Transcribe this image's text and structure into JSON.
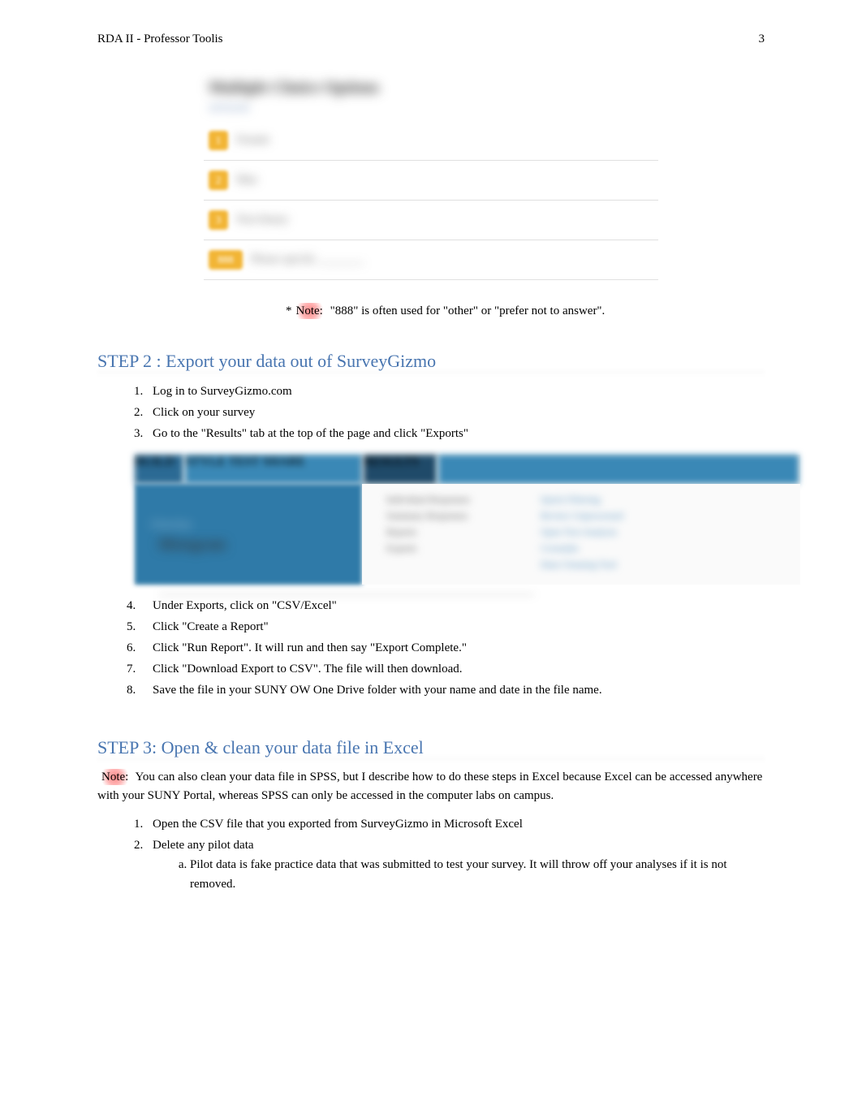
{
  "header": {
    "left": "RDA II - Professor Toolis",
    "page_number": "3"
  },
  "figure1": {
    "title": "Multiple Choice Options",
    "subtitle": "OPTIONS",
    "options": [
      {
        "num": "1",
        "label": "Female"
      },
      {
        "num": "2",
        "label": "Man"
      },
      {
        "num": "3",
        "label": "Non-binary"
      },
      {
        "num": "888",
        "label": "Please specify ________"
      }
    ]
  },
  "note1": {
    "prefix": "*",
    "highlight": "Note:",
    "rest": " \"888\" is often used for \"other\" or \"prefer not to answer\"."
  },
  "step2": {
    "heading": "STEP 2 : Export your data out of SurveyGizmo",
    "items": [
      "Log in to SurveyGizmo.com",
      "Click on your survey",
      "Go to the \"Results\" tab at the top of the page and click \"Exports\""
    ],
    "items_after": [
      "Under Exports, click on \"CSV/Excel\"",
      "Click \"Create a Report\"",
      "Click \"Run Report\". It will run and then say \"Export Complete.\"",
      "Click \"Download Export to CSV\". The file will then download.",
      "Save the file in your SUNY OW One Drive folder with your name and date in the file name."
    ]
  },
  "screenshot_blur": {
    "left_label": "Overview",
    "tab1": "BUILD",
    "tab2": "STYLE    TEST    SHARE",
    "tab3": "RESULTS",
    "col1": [
      "Individual Responses",
      "Summary Responses",
      "Reports",
      "Exports"
    ],
    "col2": [
      "Quick Filtering",
      "Review Unprocessed",
      "Open Text Analysis",
      "Crosstabs",
      "Data Cleaning Tool"
    ],
    "chart_label": "Histogram"
  },
  "step3": {
    "heading": "STEP 3: Open & clean your data file in Excel",
    "note_highlight": "Note:",
    "note_rest": " You can also clean your data file in SPSS, but I describe how to do these steps in Excel because Excel can be accessed anywhere with your SUNY Portal, whereas SPSS can only be accessed in the computer labs on campus.",
    "items": [
      "Open the CSV file that you exported from SurveyGizmo in Microsoft Excel",
      "Delete any pilot data"
    ],
    "subitems": [
      "Pilot data is fake practice data that was submitted to test your survey. It will throw off your analyses if it is not removed."
    ]
  }
}
